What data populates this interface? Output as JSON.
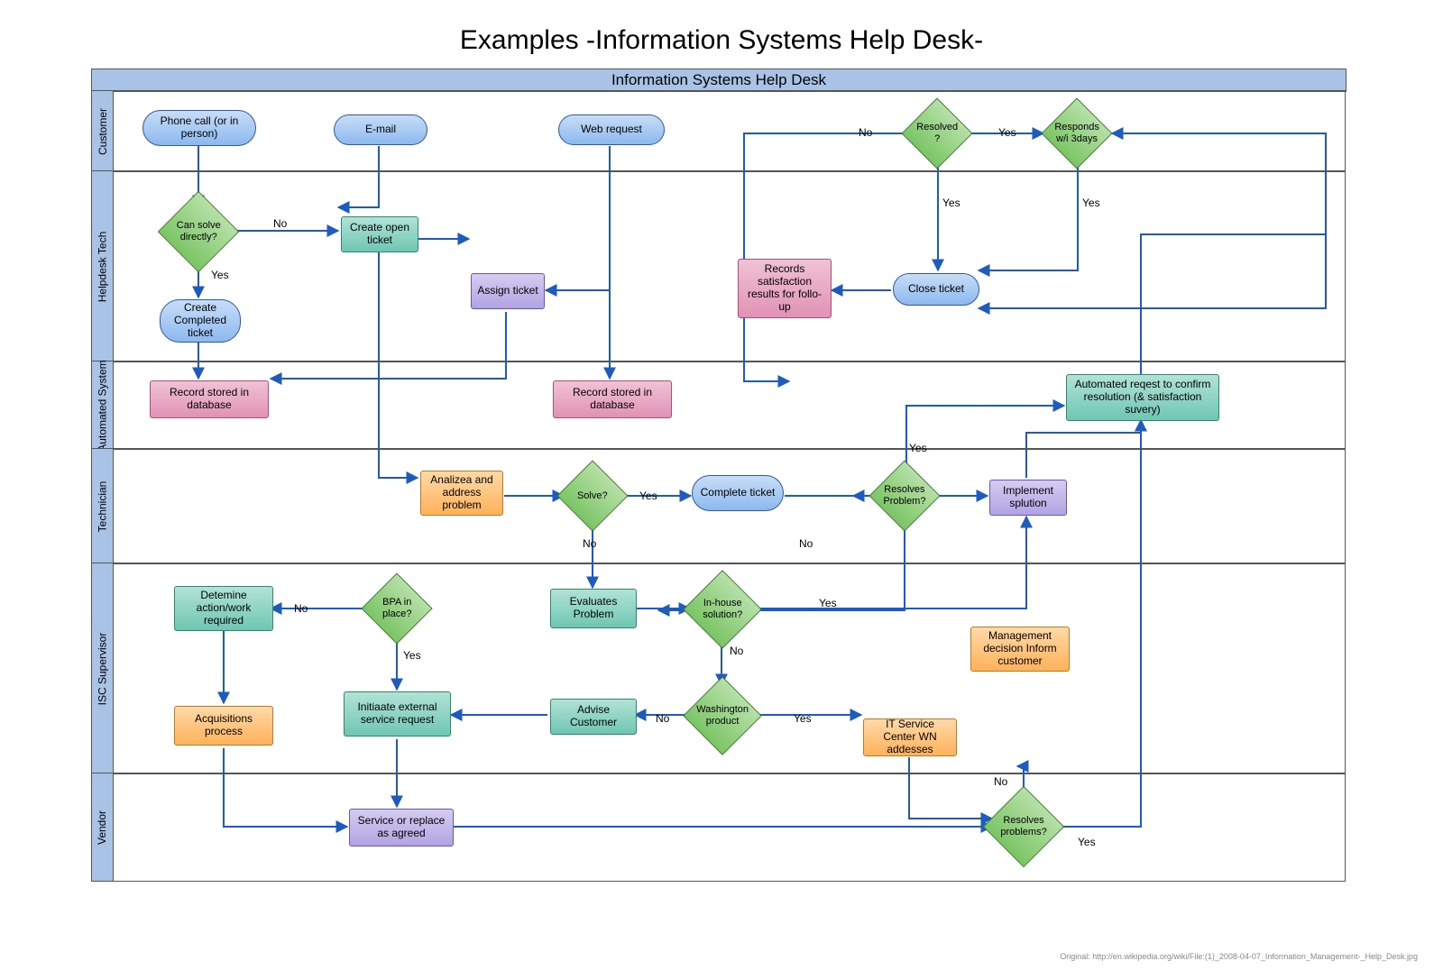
{
  "title": "Examples -Information Systems Help Desk-",
  "pool": "Information Systems Help Desk",
  "lanes": {
    "customer": "Customer",
    "helpdesk": "Helpdesk Tech",
    "automated": "Automated System",
    "technician": "Technician",
    "isc": "ISC Supervisor",
    "vendor": "Vendor"
  },
  "nodes": {
    "phone": "Phone call\n(or in person)",
    "email": "E-mail",
    "web": "Web request",
    "resolved": "Resolved\n?",
    "responds": "Responds\nw/i 3days",
    "cansolve": "Can\nsolve\ndirectly?",
    "openticket": "Create open\nticket",
    "assign": "Assign ticket",
    "completed": "Create\nCompleted\nticket",
    "close": "Close ticket",
    "satis": "Records\nsatisfaction\nresults for follo-\nup",
    "store1": "Record stored\nin database",
    "store2": "Record stored\nin database",
    "autoreq": "Automated reqest to\nconfirm resolution\n(& satisfaction suvery)",
    "analyze": "Analizea and\naddress\nproblem",
    "solve": "Solve?",
    "complete": "Complete\nticket",
    "resolves": "Resolves\nProblem?",
    "implement": "Implement\nsplution",
    "determine": "Detemine\naction/work\nrequired",
    "bpa": "BPA in\nplace?",
    "evaluate": "Evaluates\nProblem",
    "inhouse": "In-house\nsolution?",
    "mgmt": "Management\ndecision Inform\ncustomer",
    "initiate": "Initiaate external\nservice request",
    "advise": "Advise\nCustomer",
    "wash": "Washington\nproduct",
    "wn": "IT Service Center\nWN addesses",
    "acq": "Acquisitions\nprocess",
    "service": "Service or replace\nas agreed",
    "resprob": "Resolves\nproblems?"
  },
  "labels": {
    "yes": "Yes",
    "no": "No"
  },
  "footnote": "Original: http://en.wikipedia.org/wiki/File:(1)_2008-04-07_Information_Management-_Help_Desk.jpg"
}
